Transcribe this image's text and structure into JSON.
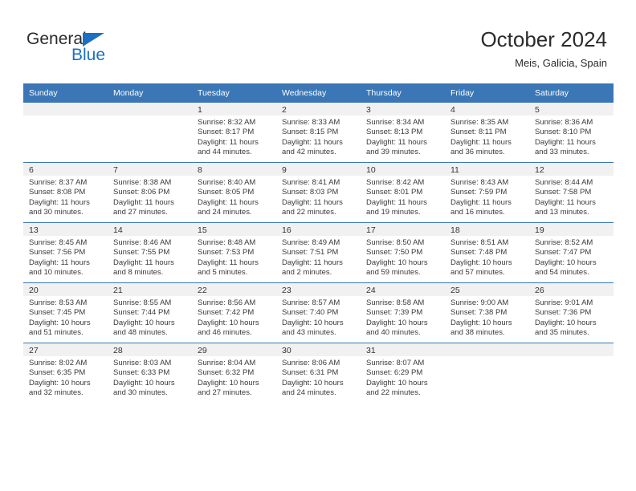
{
  "brand": {
    "name_top": "General",
    "name_bottom": "Blue",
    "accent_color": "#1a70c3",
    "logo_icon": "triangle-logo-icon"
  },
  "header": {
    "title": "October 2024",
    "subtitle": "Meis, Galicia, Spain"
  },
  "theme": {
    "header_blue": "#3b77b6",
    "daynum_band_gray": "#f1f1f1",
    "text_dark": "#2b2b2b",
    "body_text": "#3a3a3a"
  },
  "weekday_headers": [
    "Sunday",
    "Monday",
    "Tuesday",
    "Wednesday",
    "Thursday",
    "Friday",
    "Saturday"
  ],
  "weeks": [
    [
      {
        "day": "",
        "empty": true,
        "sunrise": "",
        "sunset": "",
        "daylight_line1": "",
        "daylight_line2": ""
      },
      {
        "day": "",
        "empty": true,
        "sunrise": "",
        "sunset": "",
        "daylight_line1": "",
        "daylight_line2": ""
      },
      {
        "day": "1",
        "sunrise": "Sunrise: 8:32 AM",
        "sunset": "Sunset: 8:17 PM",
        "daylight_line1": "Daylight: 11 hours",
        "daylight_line2": "and 44 minutes."
      },
      {
        "day": "2",
        "sunrise": "Sunrise: 8:33 AM",
        "sunset": "Sunset: 8:15 PM",
        "daylight_line1": "Daylight: 11 hours",
        "daylight_line2": "and 42 minutes."
      },
      {
        "day": "3",
        "sunrise": "Sunrise: 8:34 AM",
        "sunset": "Sunset: 8:13 PM",
        "daylight_line1": "Daylight: 11 hours",
        "daylight_line2": "and 39 minutes."
      },
      {
        "day": "4",
        "sunrise": "Sunrise: 8:35 AM",
        "sunset": "Sunset: 8:11 PM",
        "daylight_line1": "Daylight: 11 hours",
        "daylight_line2": "and 36 minutes."
      },
      {
        "day": "5",
        "sunrise": "Sunrise: 8:36 AM",
        "sunset": "Sunset: 8:10 PM",
        "daylight_line1": "Daylight: 11 hours",
        "daylight_line2": "and 33 minutes."
      }
    ],
    [
      {
        "day": "6",
        "sunrise": "Sunrise: 8:37 AM",
        "sunset": "Sunset: 8:08 PM",
        "daylight_line1": "Daylight: 11 hours",
        "daylight_line2": "and 30 minutes."
      },
      {
        "day": "7",
        "sunrise": "Sunrise: 8:38 AM",
        "sunset": "Sunset: 8:06 PM",
        "daylight_line1": "Daylight: 11 hours",
        "daylight_line2": "and 27 minutes."
      },
      {
        "day": "8",
        "sunrise": "Sunrise: 8:40 AM",
        "sunset": "Sunset: 8:05 PM",
        "daylight_line1": "Daylight: 11 hours",
        "daylight_line2": "and 24 minutes."
      },
      {
        "day": "9",
        "sunrise": "Sunrise: 8:41 AM",
        "sunset": "Sunset: 8:03 PM",
        "daylight_line1": "Daylight: 11 hours",
        "daylight_line2": "and 22 minutes."
      },
      {
        "day": "10",
        "sunrise": "Sunrise: 8:42 AM",
        "sunset": "Sunset: 8:01 PM",
        "daylight_line1": "Daylight: 11 hours",
        "daylight_line2": "and 19 minutes."
      },
      {
        "day": "11",
        "sunrise": "Sunrise: 8:43 AM",
        "sunset": "Sunset: 7:59 PM",
        "daylight_line1": "Daylight: 11 hours",
        "daylight_line2": "and 16 minutes."
      },
      {
        "day": "12",
        "sunrise": "Sunrise: 8:44 AM",
        "sunset": "Sunset: 7:58 PM",
        "daylight_line1": "Daylight: 11 hours",
        "daylight_line2": "and 13 minutes."
      }
    ],
    [
      {
        "day": "13",
        "sunrise": "Sunrise: 8:45 AM",
        "sunset": "Sunset: 7:56 PM",
        "daylight_line1": "Daylight: 11 hours",
        "daylight_line2": "and 10 minutes."
      },
      {
        "day": "14",
        "sunrise": "Sunrise: 8:46 AM",
        "sunset": "Sunset: 7:55 PM",
        "daylight_line1": "Daylight: 11 hours",
        "daylight_line2": "and 8 minutes."
      },
      {
        "day": "15",
        "sunrise": "Sunrise: 8:48 AM",
        "sunset": "Sunset: 7:53 PM",
        "daylight_line1": "Daylight: 11 hours",
        "daylight_line2": "and 5 minutes."
      },
      {
        "day": "16",
        "sunrise": "Sunrise: 8:49 AM",
        "sunset": "Sunset: 7:51 PM",
        "daylight_line1": "Daylight: 11 hours",
        "daylight_line2": "and 2 minutes."
      },
      {
        "day": "17",
        "sunrise": "Sunrise: 8:50 AM",
        "sunset": "Sunset: 7:50 PM",
        "daylight_line1": "Daylight: 10 hours",
        "daylight_line2": "and 59 minutes."
      },
      {
        "day": "18",
        "sunrise": "Sunrise: 8:51 AM",
        "sunset": "Sunset: 7:48 PM",
        "daylight_line1": "Daylight: 10 hours",
        "daylight_line2": "and 57 minutes."
      },
      {
        "day": "19",
        "sunrise": "Sunrise: 8:52 AM",
        "sunset": "Sunset: 7:47 PM",
        "daylight_line1": "Daylight: 10 hours",
        "daylight_line2": "and 54 minutes."
      }
    ],
    [
      {
        "day": "20",
        "sunrise": "Sunrise: 8:53 AM",
        "sunset": "Sunset: 7:45 PM",
        "daylight_line1": "Daylight: 10 hours",
        "daylight_line2": "and 51 minutes."
      },
      {
        "day": "21",
        "sunrise": "Sunrise: 8:55 AM",
        "sunset": "Sunset: 7:44 PM",
        "daylight_line1": "Daylight: 10 hours",
        "daylight_line2": "and 48 minutes."
      },
      {
        "day": "22",
        "sunrise": "Sunrise: 8:56 AM",
        "sunset": "Sunset: 7:42 PM",
        "daylight_line1": "Daylight: 10 hours",
        "daylight_line2": "and 46 minutes."
      },
      {
        "day": "23",
        "sunrise": "Sunrise: 8:57 AM",
        "sunset": "Sunset: 7:40 PM",
        "daylight_line1": "Daylight: 10 hours",
        "daylight_line2": "and 43 minutes."
      },
      {
        "day": "24",
        "sunrise": "Sunrise: 8:58 AM",
        "sunset": "Sunset: 7:39 PM",
        "daylight_line1": "Daylight: 10 hours",
        "daylight_line2": "and 40 minutes."
      },
      {
        "day": "25",
        "sunrise": "Sunrise: 9:00 AM",
        "sunset": "Sunset: 7:38 PM",
        "daylight_line1": "Daylight: 10 hours",
        "daylight_line2": "and 38 minutes."
      },
      {
        "day": "26",
        "sunrise": "Sunrise: 9:01 AM",
        "sunset": "Sunset: 7:36 PM",
        "daylight_line1": "Daylight: 10 hours",
        "daylight_line2": "and 35 minutes."
      }
    ],
    [
      {
        "day": "27",
        "sunrise": "Sunrise: 8:02 AM",
        "sunset": "Sunset: 6:35 PM",
        "daylight_line1": "Daylight: 10 hours",
        "daylight_line2": "and 32 minutes."
      },
      {
        "day": "28",
        "sunrise": "Sunrise: 8:03 AM",
        "sunset": "Sunset: 6:33 PM",
        "daylight_line1": "Daylight: 10 hours",
        "daylight_line2": "and 30 minutes."
      },
      {
        "day": "29",
        "sunrise": "Sunrise: 8:04 AM",
        "sunset": "Sunset: 6:32 PM",
        "daylight_line1": "Daylight: 10 hours",
        "daylight_line2": "and 27 minutes."
      },
      {
        "day": "30",
        "sunrise": "Sunrise: 8:06 AM",
        "sunset": "Sunset: 6:31 PM",
        "daylight_line1": "Daylight: 10 hours",
        "daylight_line2": "and 24 minutes."
      },
      {
        "day": "31",
        "sunrise": "Sunrise: 8:07 AM",
        "sunset": "Sunset: 6:29 PM",
        "daylight_line1": "Daylight: 10 hours",
        "daylight_line2": "and 22 minutes."
      },
      {
        "day": "",
        "empty": true,
        "sunrise": "",
        "sunset": "",
        "daylight_line1": "",
        "daylight_line2": ""
      },
      {
        "day": "",
        "empty": true,
        "sunrise": "",
        "sunset": "",
        "daylight_line1": "",
        "daylight_line2": ""
      }
    ]
  ]
}
